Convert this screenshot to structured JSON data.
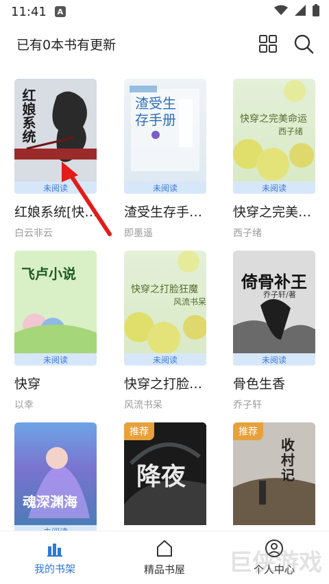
{
  "status": {
    "time": "11:41",
    "a": "A"
  },
  "header": {
    "title": "已有0本书有更新"
  },
  "books": [
    {
      "title": "红娘系统[快…",
      "author": "白云非云",
      "status": "未阅读",
      "cover_text": "红娘系统"
    },
    {
      "title": "渣受生存手…",
      "author": "即墨遥",
      "status": "未阅读",
      "cover_text": "渣受生存手册"
    },
    {
      "title": "快穿之完美…",
      "author": "西子绪",
      "status": "未阅读",
      "cover_text": "快穿之完美命运",
      "cover_sub": "西子绪"
    },
    {
      "title": "快穿",
      "author": "以幸",
      "status": "未阅读",
      "cover_text": "飞卢小说"
    },
    {
      "title": "快穿之打脸…",
      "author": "风流书呆",
      "status": "未阅读",
      "cover_text": "快穿之打脸狂魔",
      "cover_sub": "风流书呆"
    },
    {
      "title": "骨色生香",
      "author": "乔子轩",
      "status": "未阅读",
      "cover_text": "倚骨补王",
      "cover_sub": "乔子轩/著"
    },
    {
      "title": "",
      "author": "",
      "status": "未阅读",
      "cover_text": "魂深渊海"
    },
    {
      "title": "",
      "author": "",
      "tag": "推荐",
      "cover_text": "降夜"
    },
    {
      "title": "",
      "author": "",
      "tag": "推荐",
      "cover_text": "收村记"
    }
  ],
  "nav": {
    "items": [
      {
        "label": "我的书架"
      },
      {
        "label": "精品书屋"
      },
      {
        "label": "个人中心"
      }
    ]
  },
  "watermark": "巨侠游戏"
}
